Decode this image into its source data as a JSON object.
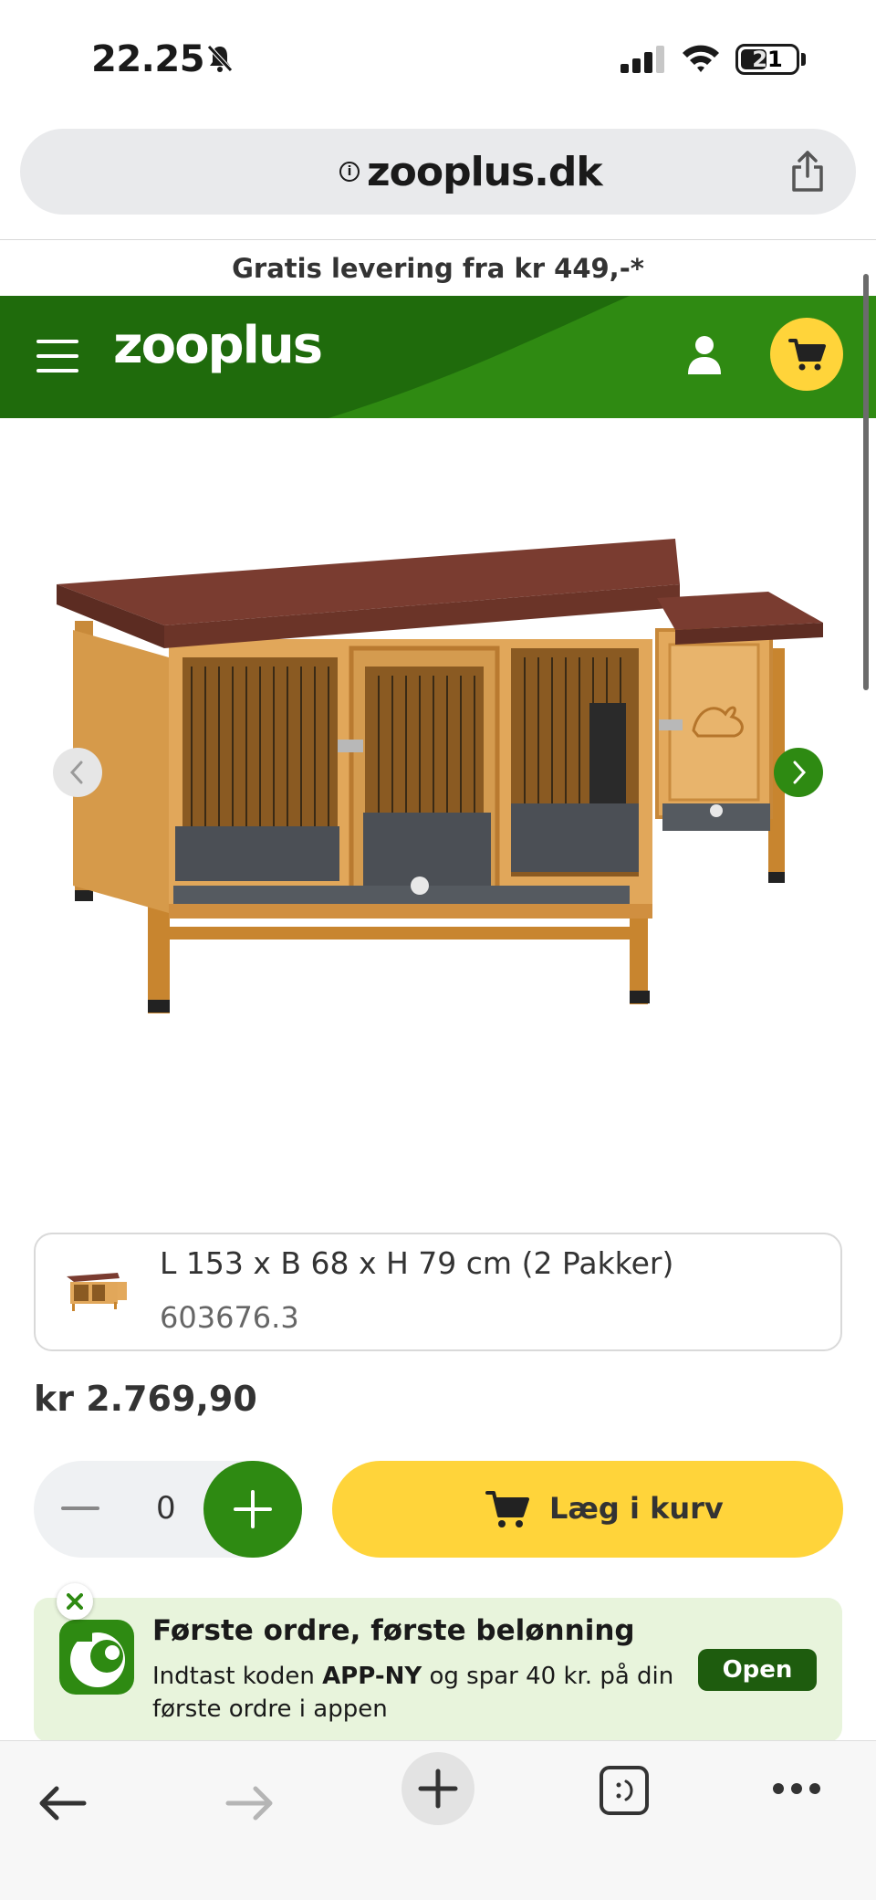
{
  "status_bar": {
    "time": "22.25",
    "battery": "21"
  },
  "browser": {
    "url": "zooplus.dk"
  },
  "promo": {
    "text": "Gratis levering fra kr 449,-*"
  },
  "header": {
    "logo": "zooplus",
    "icons": [
      "menu-icon",
      "user-icon",
      "cart-icon"
    ]
  },
  "product": {
    "variant_title": "L 153 x B 68 x H 79 cm (2 Pakker)",
    "variant_sku": "603676.3",
    "price": "kr 2.769,90"
  },
  "quantity": {
    "value": "0"
  },
  "add_to_cart": {
    "label": "Læg i kurv"
  },
  "app_banner": {
    "title": "Første ordre, første belønning",
    "text_prefix": "Indtast koden ",
    "code": "APP-NY",
    "text_suffix": " og spar 40 kr. på din første ordre i appen",
    "open_label": "Open"
  },
  "colors": {
    "brand_green": "#2f8a12",
    "dark_green": "#1e5c0e",
    "accent_yellow": "#ffd43a"
  }
}
